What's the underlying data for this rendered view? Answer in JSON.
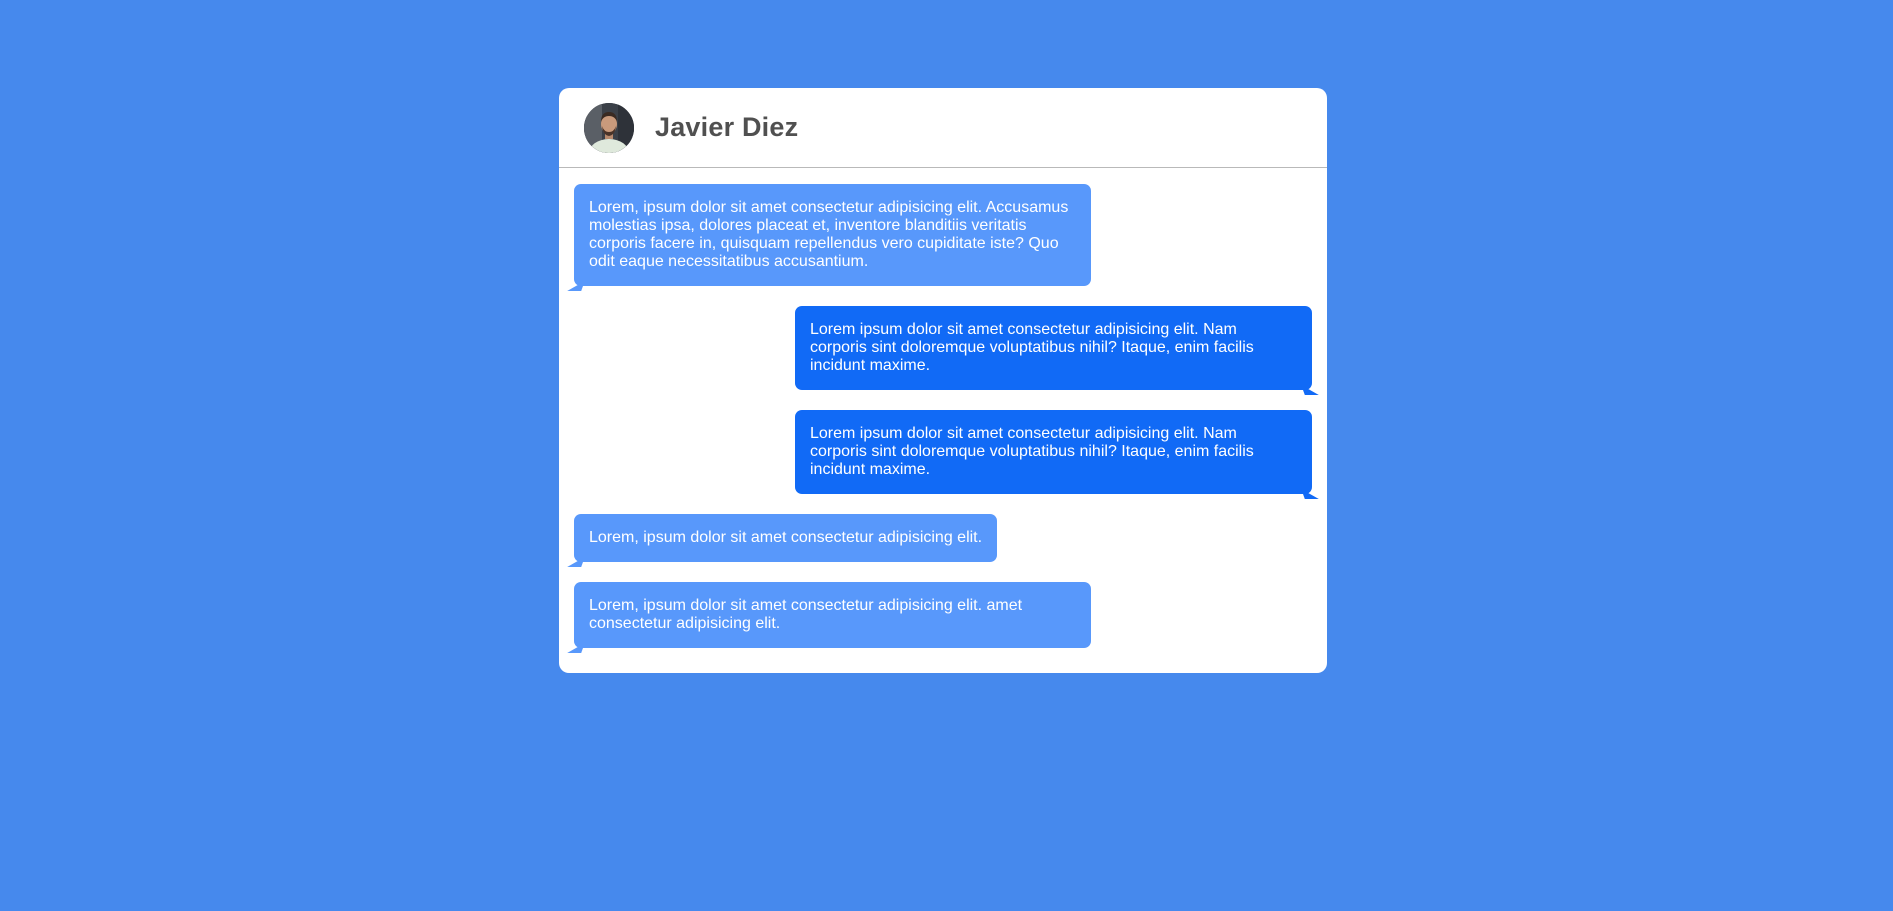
{
  "colors": {
    "background": "#4689ed",
    "card": "#ffffff",
    "received_bubble": "#5898fb",
    "sent_bubble": "#116af6",
    "name_text": "#505050"
  },
  "header": {
    "contact_name": "Javier Diez",
    "avatar_icon": "user-avatar-photo"
  },
  "messages": [
    {
      "direction": "received",
      "text": "Lorem, ipsum dolor sit amet consectetur adipisicing elit. Accusamus molestias ipsa, dolores placeat et, inventore blanditiis veritatis corporis facere in, quisquam repellendus vero cupiditate iste? Quo odit eaque necessitatibus accusantium."
    },
    {
      "direction": "sent",
      "text": "Lorem ipsum dolor sit amet consectetur adipisicing elit. Nam corporis sint doloremque voluptatibus nihil? Itaque, enim facilis incidunt maxime."
    },
    {
      "direction": "sent",
      "text": "Lorem ipsum dolor sit amet consectetur adipisicing elit. Nam corporis sint doloremque voluptatibus nihil? Itaque, enim facilis incidunt maxime."
    },
    {
      "direction": "received",
      "text": "Lorem, ipsum dolor sit amet consectetur adipisicing elit."
    },
    {
      "direction": "received",
      "text": "Lorem, ipsum dolor sit amet consectetur adipisicing elit. amet consectetur adipisicing elit."
    }
  ]
}
